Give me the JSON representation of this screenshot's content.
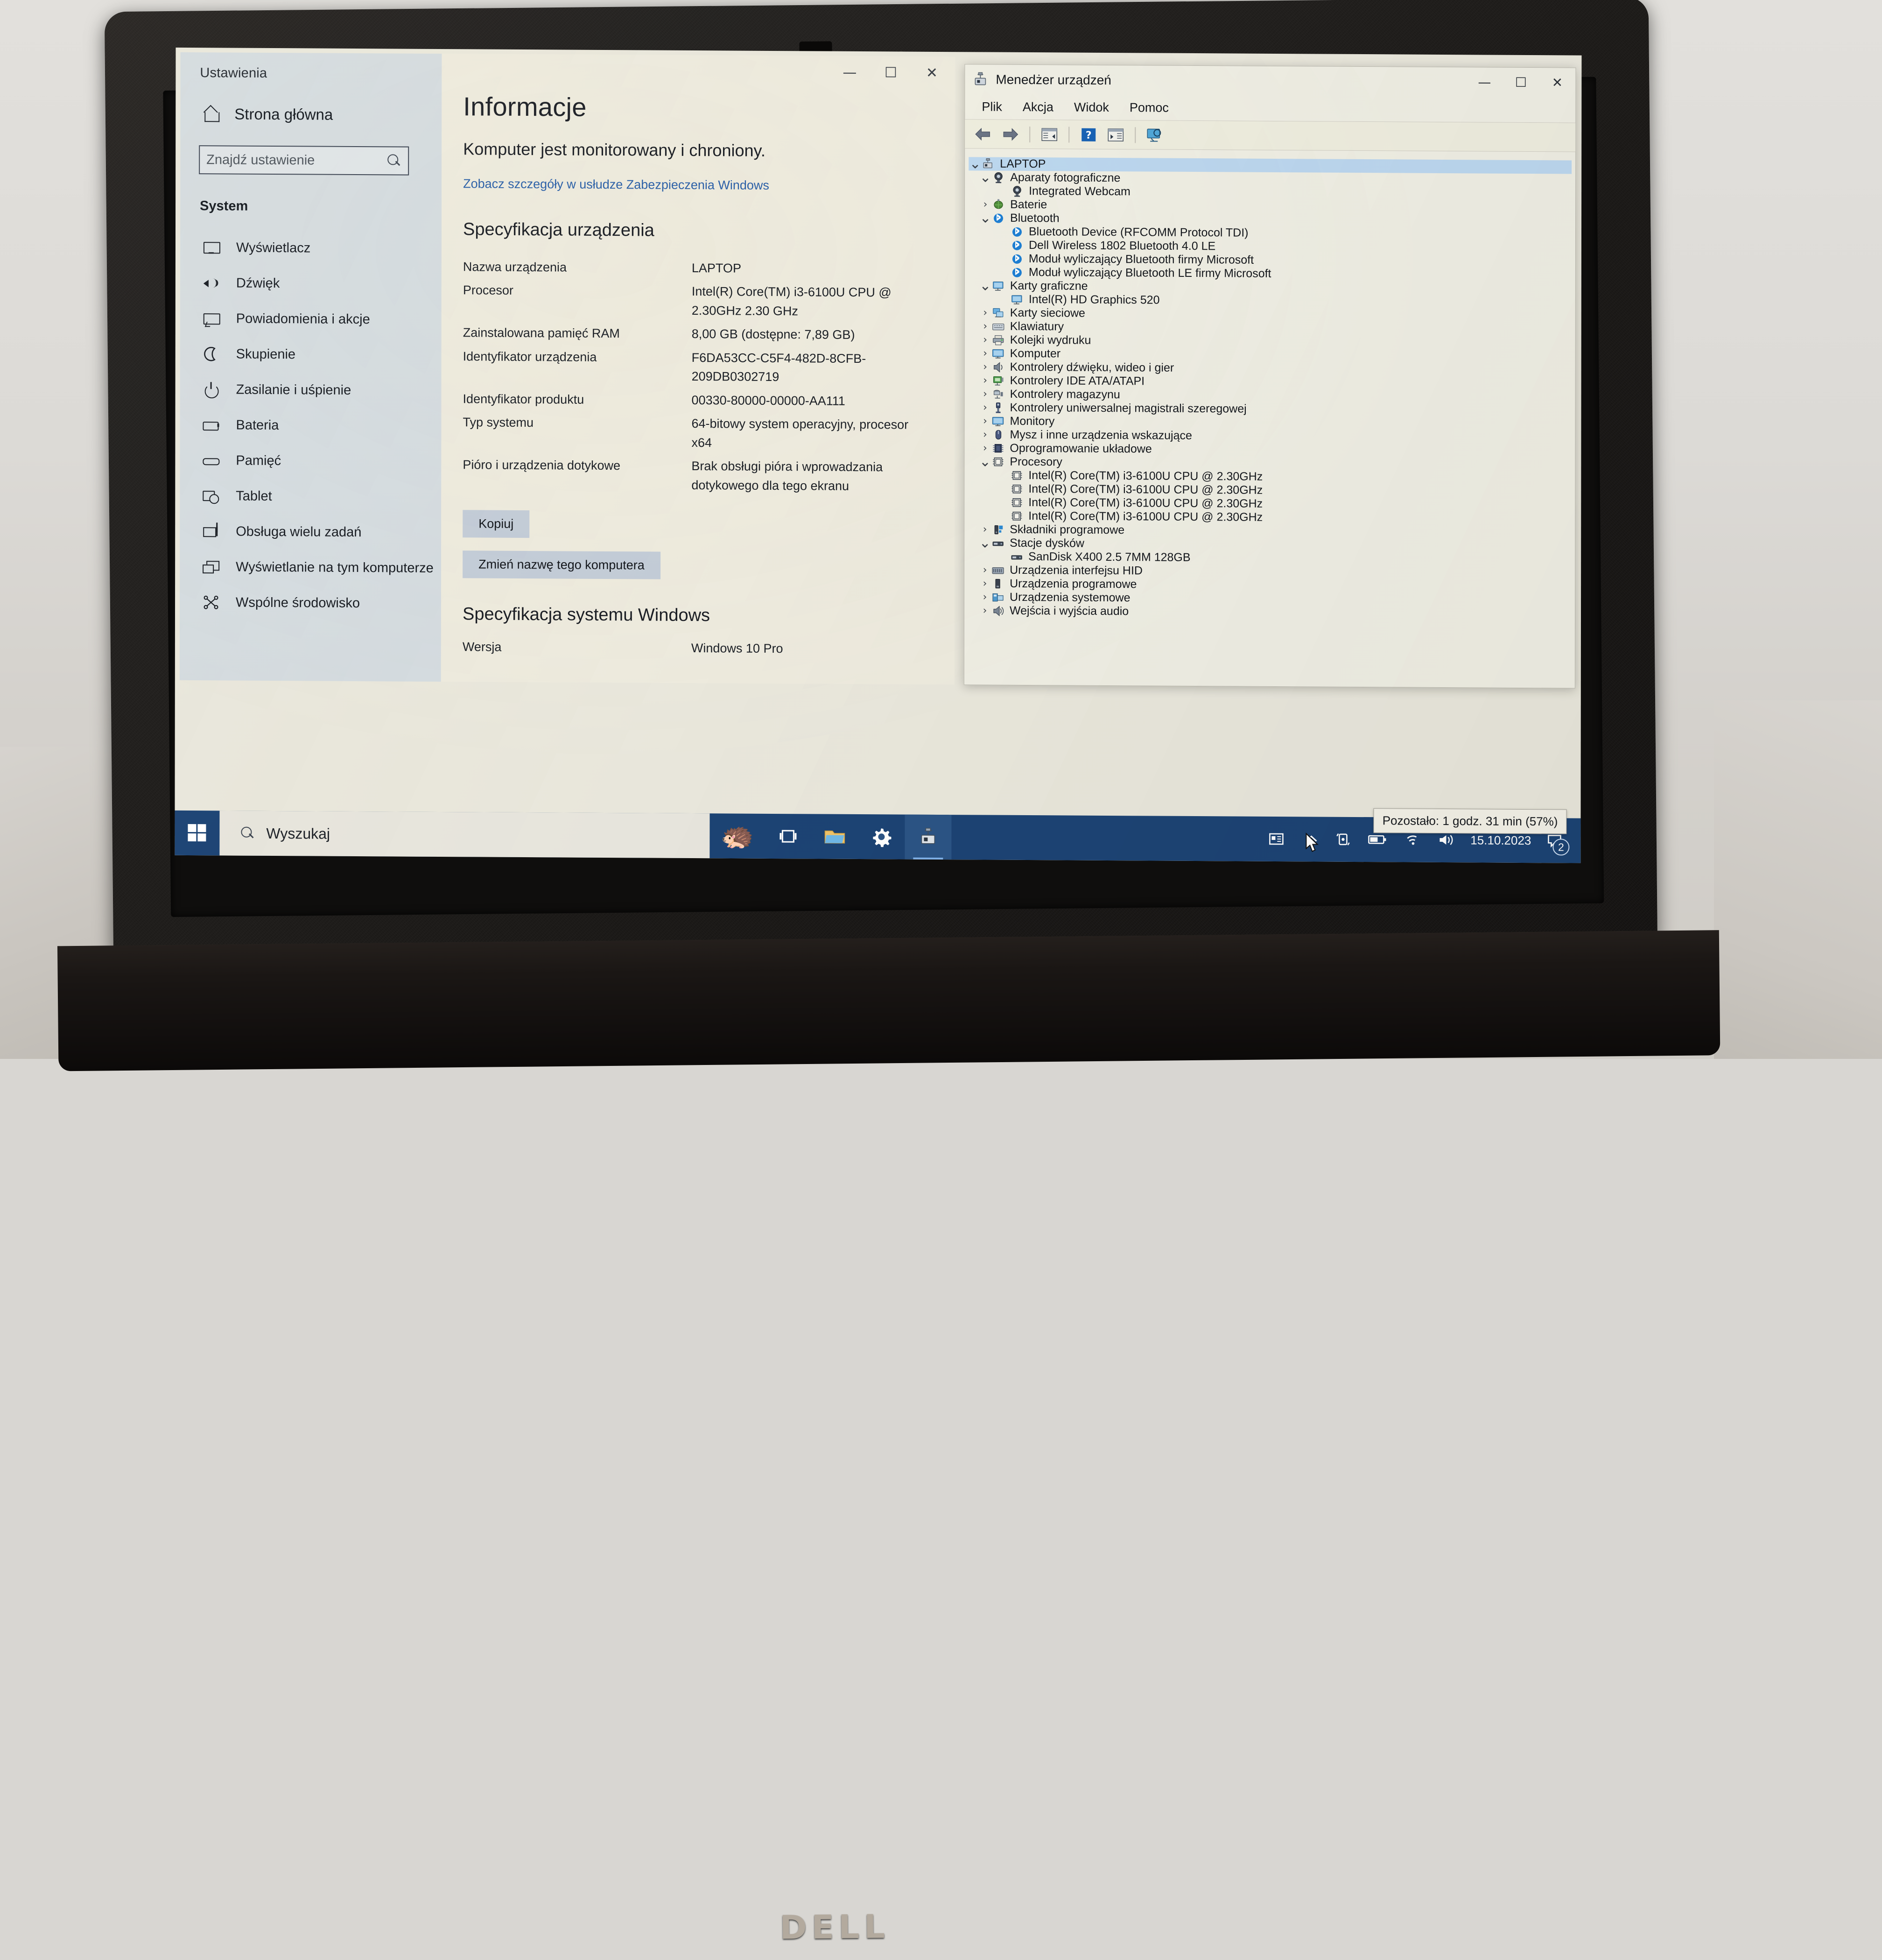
{
  "hardware": {
    "brand_logo": "DELL",
    "webcam_icon": "webcam-icon"
  },
  "settings_window": {
    "title": "Ustawienia",
    "window_controls": {
      "minimize": "—",
      "maximize": "☐",
      "close": "✕"
    },
    "sidebar": {
      "home_label": "Strona główna",
      "home_icon": "home-icon",
      "search": {
        "placeholder": "Znajdź ustawienie",
        "value": "",
        "icon": "search-icon"
      },
      "group_heading": "System",
      "items": [
        {
          "label": "Wyświetlacz",
          "icon": "display-icon"
        },
        {
          "label": "Dźwięk",
          "icon": "sound-icon"
        },
        {
          "label": "Powiadomienia i akcje",
          "icon": "notification-icon"
        },
        {
          "label": "Skupienie",
          "icon": "moon-icon"
        },
        {
          "label": "Zasilanie i uśpienie",
          "icon": "power-icon"
        },
        {
          "label": "Bateria",
          "icon": "battery-icon"
        },
        {
          "label": "Pamięć",
          "icon": "storage-icon"
        },
        {
          "label": "Tablet",
          "icon": "tablet-icon"
        },
        {
          "label": "Obsługa wielu zadań",
          "icon": "multitask-icon"
        },
        {
          "label": "Wyświetlanie na tym komputerze",
          "icon": "projecting-icon"
        },
        {
          "label": "Wspólne środowisko",
          "icon": "shared-experiences-icon"
        }
      ]
    },
    "main": {
      "page_title": "Informacje",
      "protection_status": "Komputer jest monitorowany i chroniony.",
      "security_link": "Zobacz szczegóły w usłudze Zabezpieczenia Windows",
      "device_spec_heading": "Specyfikacja urządzenia",
      "device_spec": [
        {
          "key": "Nazwa urządzenia",
          "value": "LAPTOP"
        },
        {
          "key": "Procesor",
          "value": "Intel(R) Core(TM) i3-6100U CPU @ 2.30GHz   2.30 GHz"
        },
        {
          "key": "Zainstalowana pamięć RAM",
          "value": "8,00 GB (dostępne: 7,89 GB)"
        },
        {
          "key": "Identyfikator urządzenia",
          "value": "F6DA53CC-C5F4-482D-8CFB-209DB0302719"
        },
        {
          "key": "Identyfikator produktu",
          "value": "00330-80000-00000-AA111"
        },
        {
          "key": "Typ systemu",
          "value": "64-bitowy system operacyjny, procesor x64"
        },
        {
          "key": "Pióro i urządzenia dotykowe",
          "value": "Brak obsługi pióra i wprowadzania dotykowego dla tego ekranu"
        }
      ],
      "copy_button": "Kopiuj",
      "rename_button": "Zmień nazwę tego komputera",
      "windows_spec_heading": "Specyfikacja systemu Windows",
      "windows_spec": [
        {
          "key": "Wersja",
          "value": "Windows 10 Pro"
        }
      ]
    }
  },
  "device_manager": {
    "title": "Menedżer urządzeń",
    "title_icon": "device-manager-icon",
    "window_controls": {
      "minimize": "—",
      "maximize": "☐",
      "close": "✕"
    },
    "menu": [
      "Plik",
      "Akcja",
      "Widok",
      "Pomoc"
    ],
    "toolbar_icons": [
      "back-arrow-icon",
      "forward-arrow-icon",
      "properties-icon",
      "help-icon",
      "show-hidden-icon",
      "scan-hardware-icon"
    ],
    "tree": [
      {
        "depth": 0,
        "label": "LAPTOP",
        "chev": "v",
        "icon": "computer-icon",
        "selected": true
      },
      {
        "depth": 1,
        "label": "Aparaty fotograficzne",
        "chev": "v",
        "icon": "camera-icon"
      },
      {
        "depth": 2,
        "label": "Integrated Webcam",
        "chev": "",
        "icon": "camera-icon"
      },
      {
        "depth": 1,
        "label": "Baterie",
        "chev": ">",
        "icon": "battery-node-icon"
      },
      {
        "depth": 1,
        "label": "Bluetooth",
        "chev": "v",
        "icon": "bluetooth-icon"
      },
      {
        "depth": 2,
        "label": "Bluetooth Device (RFCOMM Protocol TDI)",
        "chev": "",
        "icon": "bluetooth-icon"
      },
      {
        "depth": 2,
        "label": "Dell Wireless 1802 Bluetooth 4.0 LE",
        "chev": "",
        "icon": "bluetooth-icon"
      },
      {
        "depth": 2,
        "label": "Moduł wyliczający Bluetooth firmy Microsoft",
        "chev": "",
        "icon": "bluetooth-icon"
      },
      {
        "depth": 2,
        "label": "Moduł wyliczający Bluetooth LE firmy Microsoft",
        "chev": "",
        "icon": "bluetooth-icon"
      },
      {
        "depth": 1,
        "label": "Karty graficzne",
        "chev": "v",
        "icon": "display-adapter-icon"
      },
      {
        "depth": 2,
        "label": "Intel(R) HD Graphics 520",
        "chev": "",
        "icon": "display-adapter-icon"
      },
      {
        "depth": 1,
        "label": "Karty sieciowe",
        "chev": ">",
        "icon": "network-adapter-icon"
      },
      {
        "depth": 1,
        "label": "Klawiatury",
        "chev": ">",
        "icon": "keyboard-icon"
      },
      {
        "depth": 1,
        "label": "Kolejki wydruku",
        "chev": ">",
        "icon": "printer-icon"
      },
      {
        "depth": 1,
        "label": "Komputer",
        "chev": ">",
        "icon": "monitor-icon"
      },
      {
        "depth": 1,
        "label": "Kontrolery dźwięku, wideo i gier",
        "chev": ">",
        "icon": "speaker-icon"
      },
      {
        "depth": 1,
        "label": "Kontrolery IDE ATA/ATAPI",
        "chev": ">",
        "icon": "ide-controller-icon"
      },
      {
        "depth": 1,
        "label": "Kontrolery magazynu",
        "chev": ">",
        "icon": "storage-controller-icon"
      },
      {
        "depth": 1,
        "label": "Kontrolery uniwersalnej magistrali szeregowej",
        "chev": ">",
        "icon": "usb-icon"
      },
      {
        "depth": 1,
        "label": "Monitory",
        "chev": ">",
        "icon": "monitor-icon"
      },
      {
        "depth": 1,
        "label": "Mysz i inne urządzenia wskazujące",
        "chev": ">",
        "icon": "mouse-icon"
      },
      {
        "depth": 1,
        "label": "Oprogramowanie układowe",
        "chev": ">",
        "icon": "firmware-icon"
      },
      {
        "depth": 1,
        "label": "Procesory",
        "chev": "v",
        "icon": "processor-icon"
      },
      {
        "depth": 2,
        "label": "Intel(R) Core(TM) i3-6100U CPU @ 2.30GHz",
        "chev": "",
        "icon": "processor-icon"
      },
      {
        "depth": 2,
        "label": "Intel(R) Core(TM) i3-6100U CPU @ 2.30GHz",
        "chev": "",
        "icon": "processor-icon"
      },
      {
        "depth": 2,
        "label": "Intel(R) Core(TM) i3-6100U CPU @ 2.30GHz",
        "chev": "",
        "icon": "processor-icon"
      },
      {
        "depth": 2,
        "label": "Intel(R) Core(TM) i3-6100U CPU @ 2.30GHz",
        "chev": "",
        "icon": "processor-icon"
      },
      {
        "depth": 1,
        "label": "Składniki programowe",
        "chev": ">",
        "icon": "software-component-icon"
      },
      {
        "depth": 1,
        "label": "Stacje dysków",
        "chev": "v",
        "icon": "disk-drive-icon"
      },
      {
        "depth": 2,
        "label": "SanDisk X400 2.5 7MM 128GB",
        "chev": "",
        "icon": "disk-drive-icon"
      },
      {
        "depth": 1,
        "label": "Urządzenia interfejsu HID",
        "chev": ">",
        "icon": "hid-icon"
      },
      {
        "depth": 1,
        "label": "Urządzenia programowe",
        "chev": ">",
        "icon": "software-device-icon"
      },
      {
        "depth": 1,
        "label": "Urządzenia systemowe",
        "chev": ">",
        "icon": "system-device-icon"
      },
      {
        "depth": 1,
        "label": "Wejścia i wyjścia audio",
        "chev": ">",
        "icon": "audio-io-icon"
      }
    ]
  },
  "taskbar": {
    "start_icon": "windows-start-icon",
    "search": {
      "placeholder": "Wyszukaj",
      "value": "",
      "icon": "search-icon"
    },
    "pinned": [
      {
        "name": "hedgehog-sticker",
        "glyph": "🦔"
      },
      {
        "name": "task-view-icon"
      },
      {
        "name": "file-explorer-icon"
      },
      {
        "name": "settings-app-icon"
      },
      {
        "name": "device-manager-app-icon"
      }
    ],
    "tray": {
      "meet-now": "meet-now-icon",
      "chevron": "show-hidden-icons-icon",
      "rotation": "screen-rotation-icon",
      "battery": "battery-tray-icon",
      "network": "wifi-icon",
      "volume": "volume-icon",
      "date": "15.10.2023",
      "notification_count": "2"
    },
    "battery_tooltip": "Pozostało: 1 godz. 31 min (57%)"
  },
  "colors": {
    "taskbar": "#1c4374",
    "settings_sidebar": "#d4dbe0",
    "settings_main": "#edeade",
    "link": "#2a5fa8",
    "selection": "#bcd7ef",
    "bluetooth": "#1e7fd4"
  }
}
